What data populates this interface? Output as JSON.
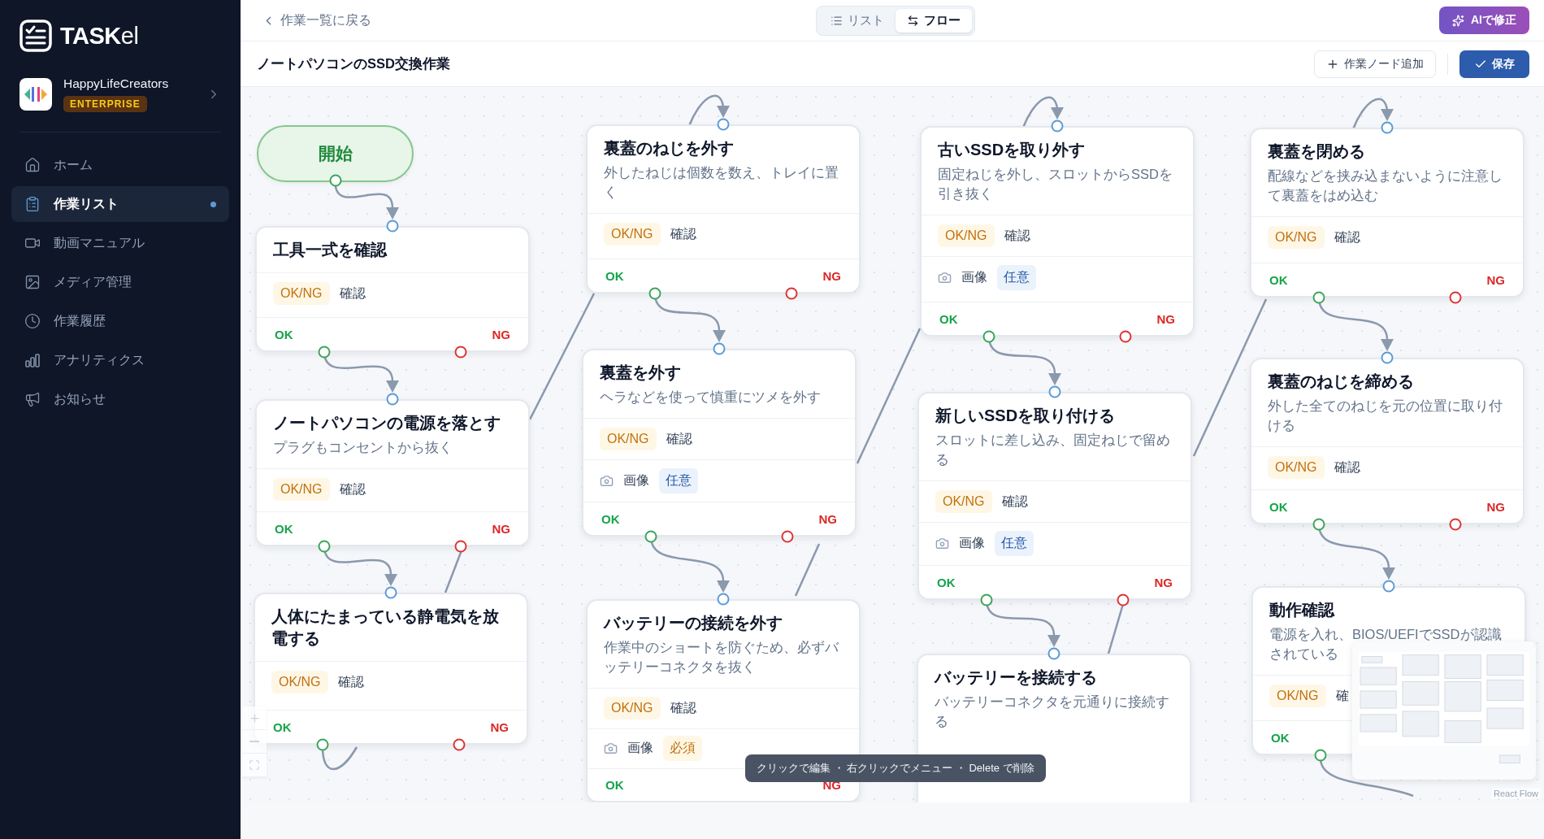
{
  "sidebar": {
    "brand": "**TASK**el",
    "org": {
      "name": "HappyLifeCreators",
      "plan": "ENTERPRISE"
    },
    "nav": [
      {
        "label": "ホーム",
        "selected": false
      },
      {
        "label": "作業リスト",
        "selected": true
      },
      {
        "label": "動画マニュアル",
        "selected": false
      },
      {
        "label": "メディア管理",
        "selected": false
      },
      {
        "label": "作業履歴",
        "selected": false
      },
      {
        "label": "アナリティクス",
        "selected": false
      },
      {
        "label": "お知らせ",
        "selected": false
      }
    ]
  },
  "header": {
    "back": "作業一覧に戻る",
    "views": [
      {
        "label": "リスト",
        "selected": false
      },
      {
        "label": "フロー",
        "selected": true
      }
    ],
    "ai_button": "AIで修正",
    "title": "ノートパソコンのSSD交換作業",
    "add_node": "作業ノード追加",
    "save": "保存"
  },
  "flow": {
    "start": "開始",
    "nodes": [
      {
        "title": "工具一式を確認",
        "rows": [
          {
            "kind": "check",
            "badge": "OK/NG",
            "label": "確認"
          }
        ],
        "ok": "OK",
        "ng": "NG"
      },
      {
        "title": "ノートパソコンの電源を落とす",
        "description": "プラグもコンセントから抜く",
        "rows": [
          {
            "kind": "check",
            "badge": "OK/NG",
            "label": "確認"
          }
        ],
        "ok": "OK",
        "ng": "NG"
      },
      {
        "title": "人体にたまっている静電気を放電する",
        "rows": [
          {
            "kind": "check",
            "badge": "OK/NG",
            "label": "確認"
          }
        ],
        "ok": "OK",
        "ng": "NG"
      },
      {
        "title": "裏蓋のねじを外す",
        "description": "外したねじは個数を数え、トレイに置く",
        "rows": [
          {
            "kind": "check",
            "badge": "OK/NG",
            "label": "確認"
          }
        ],
        "ok": "OK",
        "ng": "NG"
      },
      {
        "title": "裏蓋を外す",
        "description": "ヘラなどを使って慎重にツメを外す",
        "rows": [
          {
            "kind": "check",
            "badge": "OK/NG",
            "label": "確認"
          },
          {
            "kind": "image",
            "label": "画像",
            "badge": "任意",
            "required": false
          }
        ],
        "ok": "OK",
        "ng": "NG"
      },
      {
        "title": "バッテリーの接続を外す",
        "description": "作業中のショートを防ぐため、必ずバッテリーコネクタを抜く",
        "rows": [
          {
            "kind": "check",
            "badge": "OK/NG",
            "label": "確認"
          },
          {
            "kind": "image",
            "label": "画像",
            "badge": "必須",
            "required": true
          }
        ],
        "ok": "OK",
        "ng": "NG"
      },
      {
        "title": "古いSSDを取り外す",
        "description": "固定ねじを外し、スロットからSSDを引き抜く",
        "rows": [
          {
            "kind": "check",
            "badge": "OK/NG",
            "label": "確認"
          },
          {
            "kind": "image",
            "label": "画像",
            "badge": "任意",
            "required": false
          }
        ],
        "ok": "OK",
        "ng": "NG"
      },
      {
        "title": "新しいSSDを取り付ける",
        "description": "スロットに差し込み、固定ねじで留める",
        "rows": [
          {
            "kind": "check",
            "badge": "OK/NG",
            "label": "確認"
          },
          {
            "kind": "image",
            "label": "画像",
            "badge": "任意",
            "required": false
          }
        ],
        "ok": "OK",
        "ng": "NG"
      },
      {
        "title": "バッテリーを接続する",
        "description": "バッテリーコネクタを元通りに接続する"
      },
      {
        "title": "裏蓋を閉める",
        "description": "配線などを挟み込まないように注意して裏蓋をはめ込む",
        "rows": [
          {
            "kind": "check",
            "badge": "OK/NG",
            "label": "確認"
          }
        ],
        "ok": "OK",
        "ng": "NG"
      },
      {
        "title": "裏蓋のねじを締める",
        "description": "外した全てのねじを元の位置に取り付ける",
        "rows": [
          {
            "kind": "check",
            "badge": "OK/NG",
            "label": "確認"
          }
        ],
        "ok": "OK",
        "ng": "NG"
      },
      {
        "title": "動作確認",
        "description": "電源を入れ、BIOS/UEFIでSSDが認識されている",
        "rows": [
          {
            "kind": "check",
            "badge": "OK/NG",
            "label": "確"
          }
        ],
        "ok": "OK"
      }
    ],
    "tooltip": "クリックで編集 ・ 右クリックでメニュー ・ Delete で削除",
    "attribution": "React Flow"
  }
}
